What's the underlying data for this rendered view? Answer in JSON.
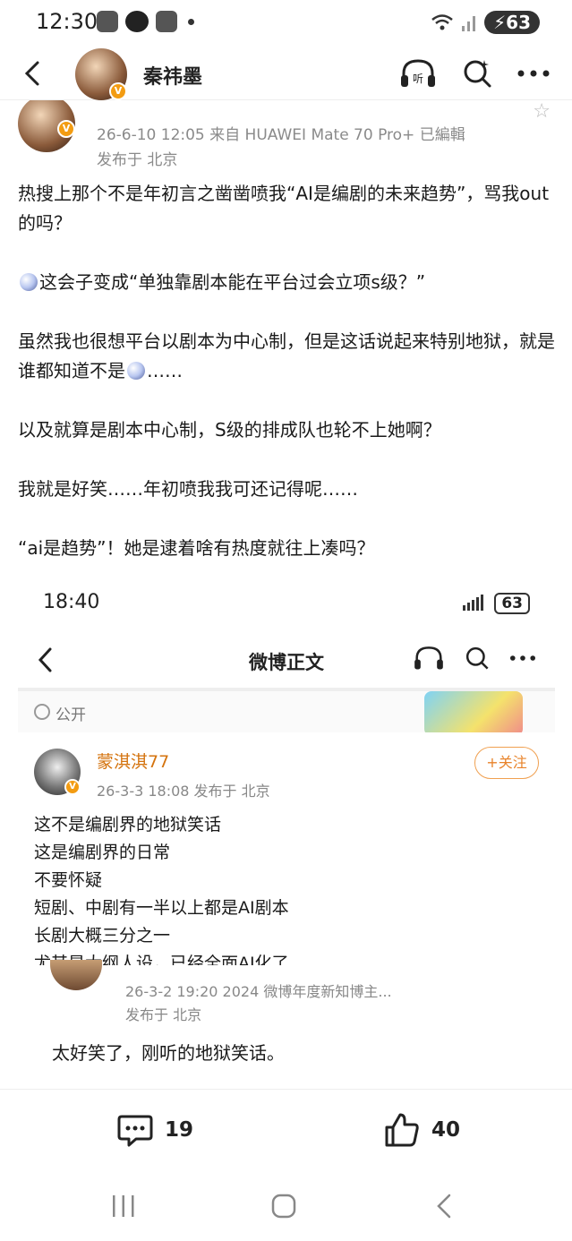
{
  "status_bar": {
    "time": "12:30",
    "battery": "63"
  },
  "nav": {
    "username": "秦祎墨"
  },
  "post": {
    "date_device": "26-6-10 12:05   来自 HUAWEI Mate 70 Pro+   已編輯",
    "location": "发布于 北京",
    "paragraphs": {
      "p1": "热搜上那个不是年初言之凿凿喷我“AI是编剧的未来趋势”，骂我out的吗？",
      "p2": "这会子变成“单独靠剧本能在平台过会立项s级？”",
      "p3a": "虽然我也很想平台以剧本为中心制，但是这话说起来特别地狱，就是谁都知道不是",
      "p3b": "……",
      "p4": "以及就算是剧本中心制，S级的排成队也轮不上她啊？",
      "p5": "我就是好笑……年初喷我我可还记得呢……",
      "p6": "“ai是趋势”！她是逮着啥有热度就往上凑吗？"
    }
  },
  "screenshot": {
    "time": "18:40",
    "battery": "63",
    "title": "微博正文",
    "visibility": "公开",
    "author": "蒙淇淇77",
    "date": "26-3-3 18:08  发布于 北京",
    "follow": "+关注",
    "lines": {
      "l1": "这不是编剧界的地狱笑话",
      "l2": "这是编剧界的日常",
      "l3": "不要怀疑",
      "l4": "短剧、中剧有一半以上都是AI剧本",
      "l5": "长剧大概三分之一",
      "l6": "尤其是大纲人设，已经全面AI化了"
    },
    "comment_date": "26-3-2 19:20  2024 微博年度新知博主...",
    "comment_location": "发布于 北京",
    "comment_text": "太好笑了，刚听的地狱笑话。"
  },
  "actions": {
    "comments": "19",
    "likes": "40"
  },
  "colors": {
    "accent": "#f39c12",
    "name_orange": "#d4730e"
  }
}
